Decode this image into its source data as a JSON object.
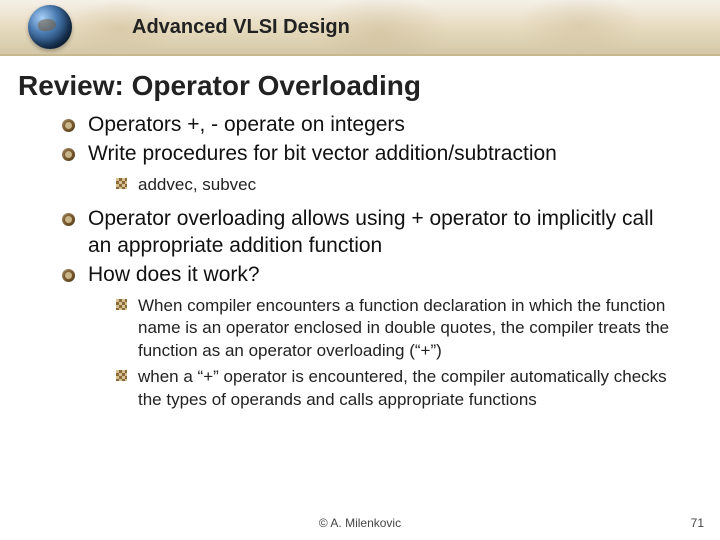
{
  "header": {
    "course_title": "Advanced VLSI Design"
  },
  "slide": {
    "title": "Review: Operator Overloading"
  },
  "bullets": {
    "b1": "Operators +, - operate on integers",
    "b2": "Write procedures for bit vector addition/subtraction",
    "b2_1": "addvec, subvec",
    "b3": "Operator overloading allows using + operator to implicitly call an appropriate addition function",
    "b4": "How does it work?",
    "b4_1": "When compiler encounters a function declaration in which the function name is an operator enclosed in double quotes, the compiler treats the function as an operator overloading (“+”)",
    "b4_2": "when a “+” operator is encountered, the compiler automatically checks the types of operands and calls appropriate functions"
  },
  "footer": {
    "copyright": "©  A. Milenkovic",
    "page": "71"
  }
}
